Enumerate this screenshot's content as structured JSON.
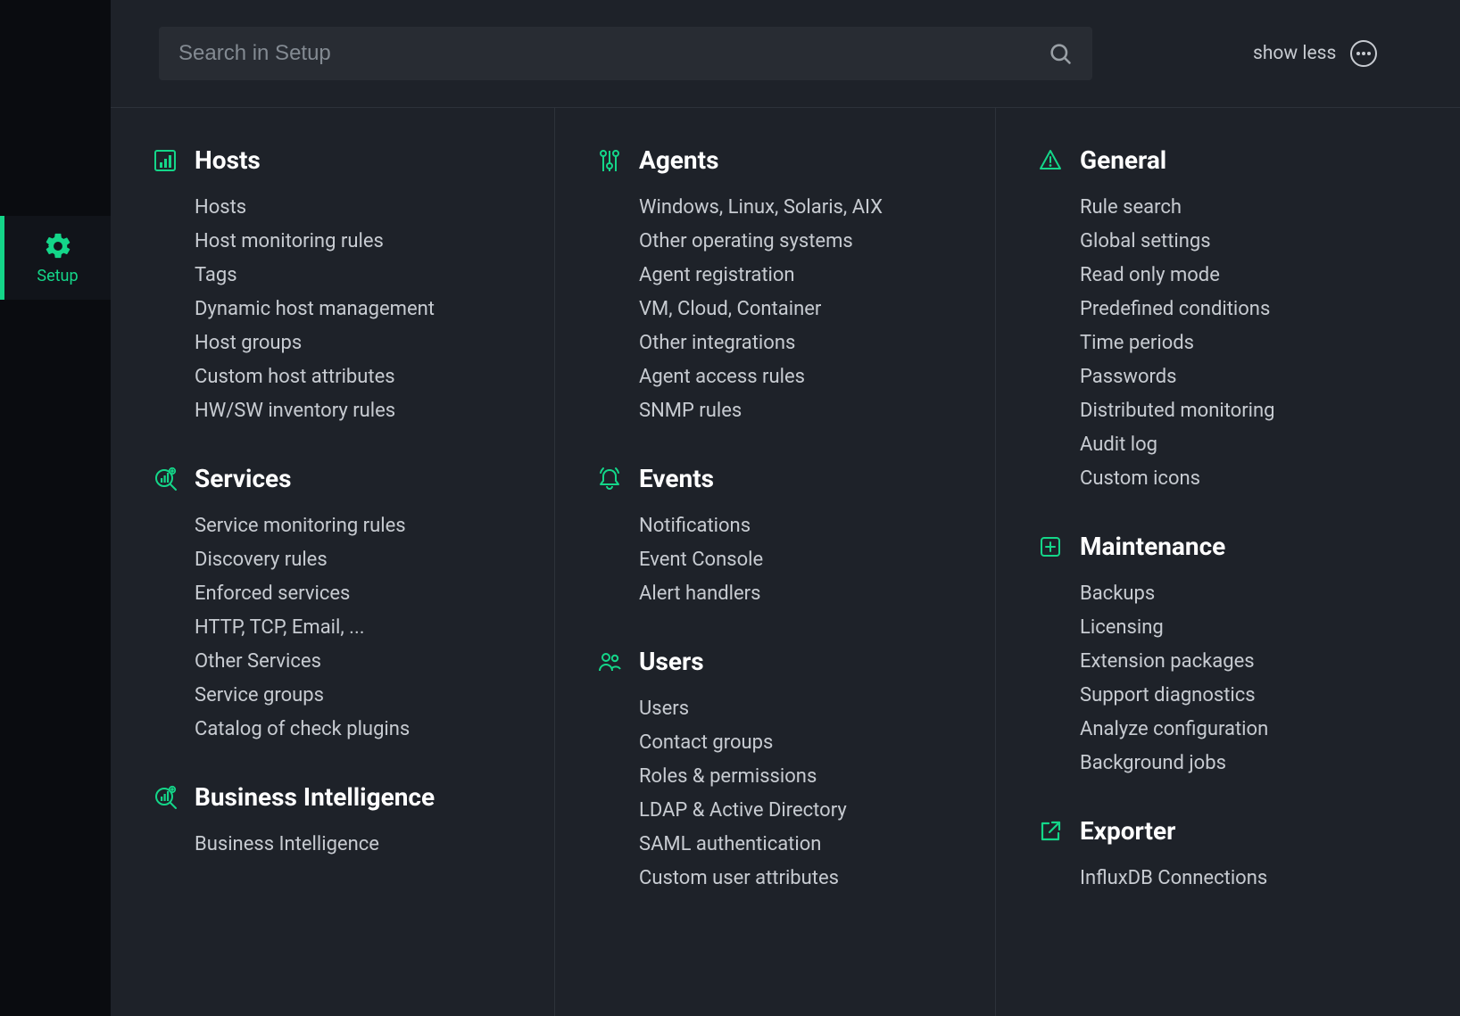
{
  "colors": {
    "accent": "#14d689",
    "bg_app": "#1e2229",
    "bg_sidebar": "#0a0c10",
    "bg_input": "#282c33",
    "text_primary": "#ffffff",
    "text_secondary": "#c7cbd1"
  },
  "sidebar": {
    "active": {
      "label": "Setup"
    }
  },
  "search": {
    "placeholder": "Search in Setup"
  },
  "header": {
    "show_less": "show less"
  },
  "columns": [
    {
      "sections": [
        {
          "icon": "hosts-icon",
          "title": "Hosts",
          "items": [
            "Hosts",
            "Host monitoring rules",
            "Tags",
            "Dynamic host management",
            "Host groups",
            "Custom host attributes",
            "HW/SW inventory rules"
          ]
        },
        {
          "icon": "services-icon",
          "title": "Services",
          "items": [
            "Service monitoring rules",
            "Discovery rules",
            "Enforced services",
            "HTTP, TCP, Email, ...",
            "Other Services",
            "Service groups",
            "Catalog of check plugins"
          ]
        },
        {
          "icon": "bi-icon",
          "title": "Business Intelligence",
          "items": [
            "Business Intelligence"
          ]
        }
      ]
    },
    {
      "sections": [
        {
          "icon": "agents-icon",
          "title": "Agents",
          "items": [
            "Windows, Linux, Solaris, AIX",
            "Other operating systems",
            "Agent registration",
            "VM, Cloud, Container",
            "Other integrations",
            "Agent access rules",
            "SNMP rules"
          ]
        },
        {
          "icon": "events-icon",
          "title": "Events",
          "items": [
            "Notifications",
            "Event Console",
            "Alert handlers"
          ]
        },
        {
          "icon": "users-icon",
          "title": "Users",
          "items": [
            "Users",
            "Contact groups",
            "Roles & permissions",
            "LDAP & Active Directory",
            "SAML authentication",
            "Custom user attributes"
          ]
        }
      ]
    },
    {
      "sections": [
        {
          "icon": "general-icon",
          "title": "General",
          "items": [
            "Rule search",
            "Global settings",
            "Read only mode",
            "Predefined conditions",
            "Time periods",
            "Passwords",
            "Distributed monitoring",
            "Audit log",
            "Custom icons"
          ]
        },
        {
          "icon": "maintenance-icon",
          "title": "Maintenance",
          "items": [
            "Backups",
            "Licensing",
            "Extension packages",
            "Support diagnostics",
            "Analyze configuration",
            "Background jobs"
          ]
        },
        {
          "icon": "exporter-icon",
          "title": "Exporter",
          "items": [
            "InfluxDB Connections"
          ]
        }
      ]
    }
  ]
}
